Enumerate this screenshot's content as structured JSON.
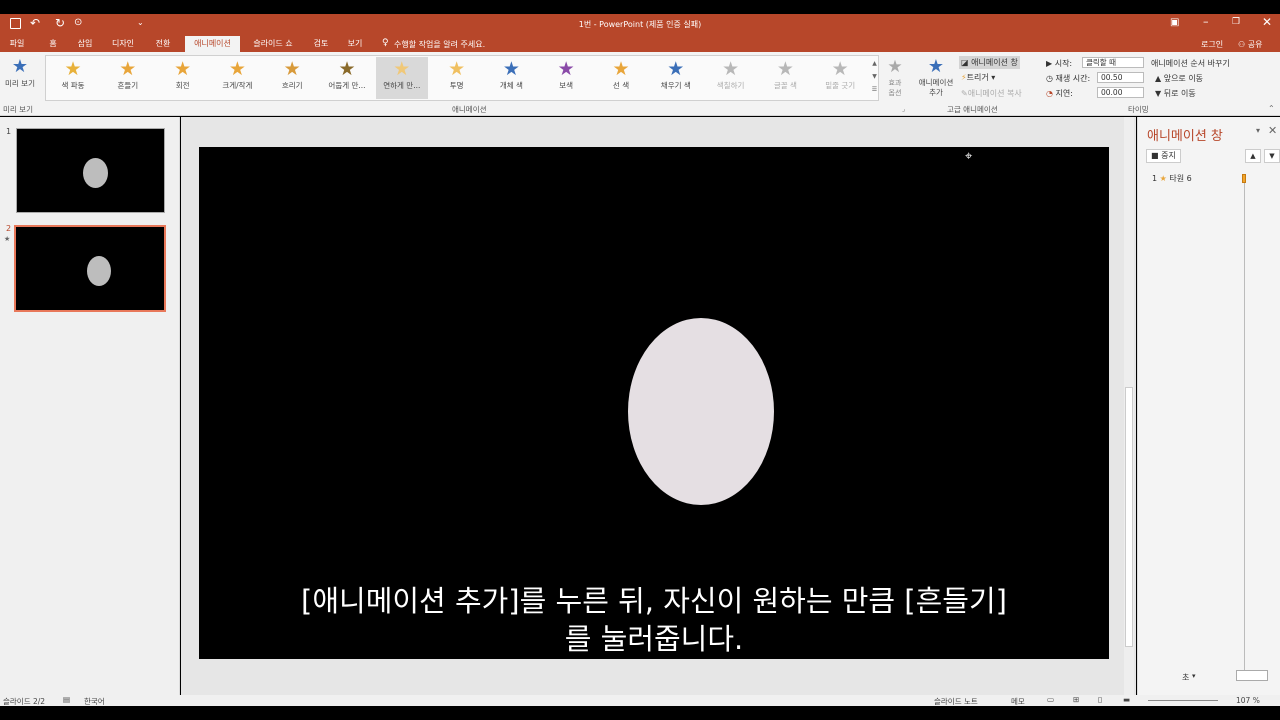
{
  "window": {
    "title": "1번 - PowerPoint (제품 인증 실패)",
    "login": "로그인",
    "share": "공유"
  },
  "tabs": [
    "파일",
    "홈",
    "삽입",
    "디자인",
    "전환",
    "애니메이션",
    "슬라이드 쇼",
    "검토",
    "보기"
  ],
  "active_tab_index": 5,
  "tell_me": "수행할 작업을 알려 주세요.",
  "ribbon": {
    "preview": {
      "label": "미리 보기",
      "group": "미리 보기"
    },
    "gallery": [
      {
        "label": "색 파동",
        "color": "#e8b13a"
      },
      {
        "label": "흔들기",
        "color": "#e8a53a"
      },
      {
        "label": "회전",
        "color": "#e8a53a"
      },
      {
        "label": "크게/작게",
        "color": "#e8a53a"
      },
      {
        "label": "흐리기",
        "color": "#d89a3a"
      },
      {
        "label": "어둡게 만...",
        "color": "#8a6a2a"
      },
      {
        "label": "연하게 만...",
        "color": "#f0c878"
      },
      {
        "label": "투명",
        "color": "#f0c060"
      },
      {
        "label": "개체 색",
        "color": "#3b6fb8"
      },
      {
        "label": "보색",
        "color": "#8a4aa8"
      },
      {
        "label": "선 색",
        "color": "#e8a53a"
      },
      {
        "label": "채우기 색",
        "color": "#3b6fb8"
      },
      {
        "label": "색칠하기",
        "color": "#b8b8b8"
      },
      {
        "label": "글꼴 색",
        "color": "#b8b8b8"
      },
      {
        "label": "밑줄 긋기",
        "color": "#b8b8b8"
      }
    ],
    "gallery_selected_index": 6,
    "gallery_dim_from": 12,
    "effect_options": "효과\n옵션",
    "animation_group": "애니메이션",
    "add_animation": "애니메이션\n추가",
    "anim_pane_btn": "애니메이션 창",
    "trigger": "트리거",
    "anim_painter": "애니메이션 복사",
    "advanced_group": "고급 애니메이션",
    "start_label": "시작:",
    "start_value": "클릭할 때",
    "duration_label": "재생 시간:",
    "duration_value": "00.50",
    "delay_label": "지연:",
    "delay_value": "00.00",
    "reorder_title": "애니메이션 순서 바꾸기",
    "move_earlier": "앞으로 이동",
    "move_later": "뒤로 이동",
    "timing_group": "타이밍"
  },
  "thumbnails": [
    {
      "number": "1"
    },
    {
      "number": "2",
      "star": "★"
    }
  ],
  "subtitle": {
    "line1": "[애니메이션 추가]를 누른 뒤, 자신이 원하는 만큼 [흔들기]",
    "line2": "를 눌러줍니다."
  },
  "anim_pane": {
    "title": "애니메이션 창",
    "play_btn": "중지",
    "items": [
      {
        "number": "1",
        "name": "타원 6"
      }
    ],
    "seconds": "초"
  },
  "status": {
    "slide": "슬라이드 2/2",
    "lang": "한국어",
    "notes": "슬라이드 노트",
    "comments": "메모",
    "zoom": "107 %"
  },
  "colors": {
    "accent": "#b7472a",
    "ellipse": "#e5dfe3"
  }
}
